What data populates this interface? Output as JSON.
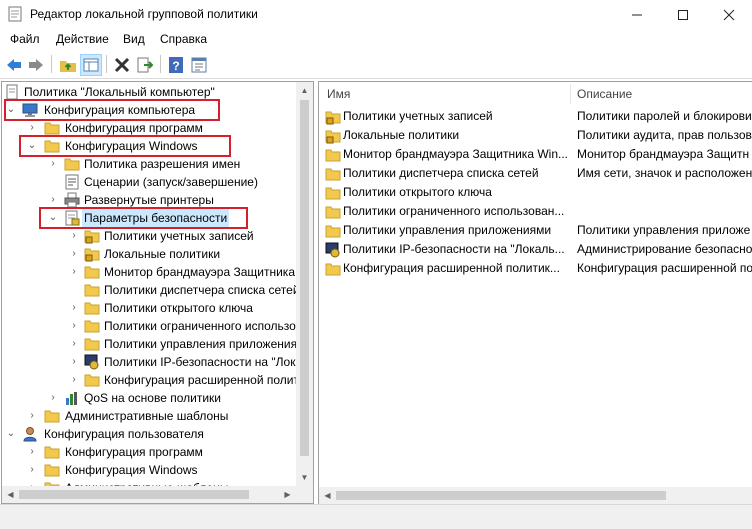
{
  "window": {
    "title": "Редактор локальной групповой политики"
  },
  "menu": [
    "Файл",
    "Действие",
    "Вид",
    "Справка"
  ],
  "colors": {
    "highlight_box": "#d4202a",
    "selection": "#cce8ff",
    "folder": "#f2c94c"
  },
  "tree": {
    "root": "Политика \"Локальный компьютер\"",
    "items": [
      {
        "label": "Конфигурация компьютера",
        "icon": "computer-icon",
        "expanded": true
      },
      {
        "label": "Конфигурация программ",
        "icon": "folder-icon"
      },
      {
        "label": "Конфигурация Windows",
        "icon": "folder-icon",
        "expanded": true
      },
      {
        "label": "Политика разрешения имен",
        "icon": "folder-icon"
      },
      {
        "label": "Сценарии (запуск/завершение)",
        "icon": "script-icon"
      },
      {
        "label": "Развернутые принтеры",
        "icon": "printer-icon"
      },
      {
        "label": "Параметры безопасности",
        "icon": "security-settings-icon",
        "expanded": true,
        "selected": true
      },
      {
        "label": "Политики учетных записей",
        "icon": "locked-folder-icon"
      },
      {
        "label": "Локальные политики",
        "icon": "locked-folder-icon"
      },
      {
        "label": "Монитор брандмауэра Защитника",
        "icon": "folder-icon"
      },
      {
        "label": "Политики диспетчера списка сетей",
        "icon": "folder-icon"
      },
      {
        "label": "Политики открытого ключа",
        "icon": "folder-icon"
      },
      {
        "label": "Политики ограниченного использо",
        "icon": "folder-icon"
      },
      {
        "label": "Политики управления приложения",
        "icon": "folder-icon"
      },
      {
        "label": "Политики IP-безопасности на \"Лок",
        "icon": "ipsec-icon"
      },
      {
        "label": "Конфигурация расширенной полит",
        "icon": "folder-icon"
      },
      {
        "label": "QoS на основе политики",
        "icon": "chart-icon"
      },
      {
        "label": "Административные шаблоны",
        "icon": "folder-icon"
      },
      {
        "label": "Конфигурация пользователя",
        "icon": "user-icon",
        "expanded": true
      },
      {
        "label": "Конфигурация программ",
        "icon": "folder-icon"
      },
      {
        "label": "Конфигурация Windows",
        "icon": "folder-icon"
      },
      {
        "label": "Административные шаблоны",
        "icon": "folder-icon"
      }
    ]
  },
  "list": {
    "columns": [
      "Имя",
      "Описание"
    ],
    "rows": [
      {
        "name": "Политики учетных записей",
        "desc": "Политики паролей и блокирови",
        "icon": "locked-folder-icon"
      },
      {
        "name": "Локальные политики",
        "desc": "Политики аудита, прав пользов",
        "icon": "locked-folder-icon"
      },
      {
        "name": "Монитор брандмауэра Защитника Win...",
        "desc": "Монитор брандмауэра Защитн",
        "icon": "folder-icon"
      },
      {
        "name": "Политики диспетчера списка сетей",
        "desc": "Имя сети, значок и расположен",
        "icon": "folder-icon"
      },
      {
        "name": "Политики открытого ключа",
        "desc": "",
        "icon": "folder-icon"
      },
      {
        "name": "Политики ограниченного использован...",
        "desc": "",
        "icon": "folder-icon"
      },
      {
        "name": "Политики управления приложениями",
        "desc": "Политики управления приложе",
        "icon": "folder-icon"
      },
      {
        "name": "Политики IP-безопасности на \"Локаль...",
        "desc": "Администрирование безопасно",
        "icon": "ipsec-icon"
      },
      {
        "name": "Конфигурация расширенной политик...",
        "desc": "Конфигурация расширенной по",
        "icon": "folder-icon"
      }
    ]
  }
}
